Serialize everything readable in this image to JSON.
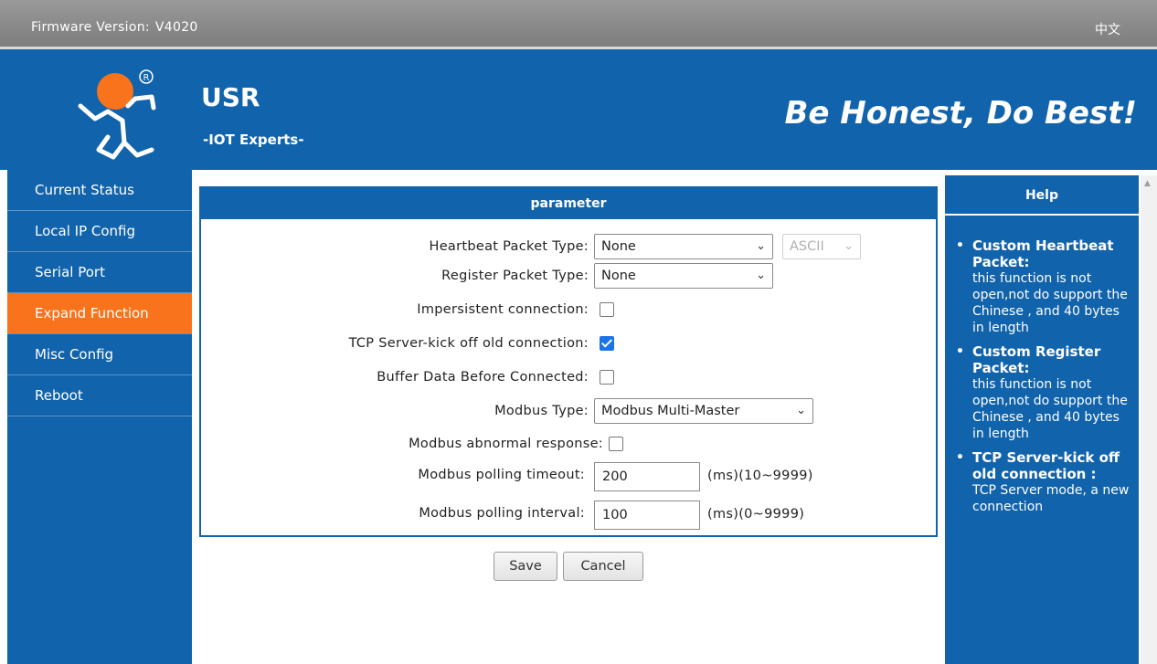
{
  "topbar": {
    "firmware_label": "Firmware Version:",
    "firmware_version": "V4020",
    "language_link": "中文"
  },
  "header": {
    "brand": "USR",
    "brand_sub": "-IOT Experts-",
    "slogan": "Be Honest, Do Best!"
  },
  "sidebar": {
    "items": [
      {
        "label": "Current Status"
      },
      {
        "label": "Local IP Config"
      },
      {
        "label": "Serial Port"
      },
      {
        "label": "Expand Function",
        "active": true
      },
      {
        "label": "Misc Config"
      },
      {
        "label": "Reboot"
      }
    ]
  },
  "panel": {
    "title": "parameter",
    "heartbeat": {
      "label": "Heartbeat Packet Type:",
      "value": "None",
      "format_value": "ASCII"
    },
    "register": {
      "label": "Register Packet Type:",
      "value": "None"
    },
    "impersistent": {
      "label": "Impersistent connection:",
      "checked": false
    },
    "kickoff": {
      "label": "TCP Server-kick off old connection:",
      "checked": true
    },
    "buffer": {
      "label": "Buffer Data Before Connected:",
      "checked": false
    },
    "modbus_type": {
      "label": "Modbus Type:",
      "value": "Modbus Multi-Master"
    },
    "modbus_abnormal": {
      "label": "Modbus abnormal response:",
      "checked": false
    },
    "polling_timeout": {
      "label": "Modbus polling timeout:",
      "value": "200",
      "unit": "(ms)(10~9999)"
    },
    "polling_interval": {
      "label": "Modbus polling interval:",
      "value": "100",
      "unit": "(ms)(0~9999)"
    }
  },
  "buttons": {
    "save": "Save",
    "cancel": "Cancel"
  },
  "help": {
    "title": "Help",
    "items": [
      {
        "heading": "Custom Heartbeat Packet:",
        "text": "this function is not open,not do support the Chinese , and 40 bytes in length"
      },
      {
        "heading": "Custom Register Packet:",
        "text": "this function is not open,not do support the Chinese , and 40 bytes in length"
      },
      {
        "heading": "TCP Server-kick off old connection :",
        "text": "TCP Server mode, a new connection"
      }
    ]
  },
  "colors": {
    "brand_blue": "#1163ab",
    "active_orange": "#f8731c",
    "topbar_gray": "#8a8a8a"
  }
}
